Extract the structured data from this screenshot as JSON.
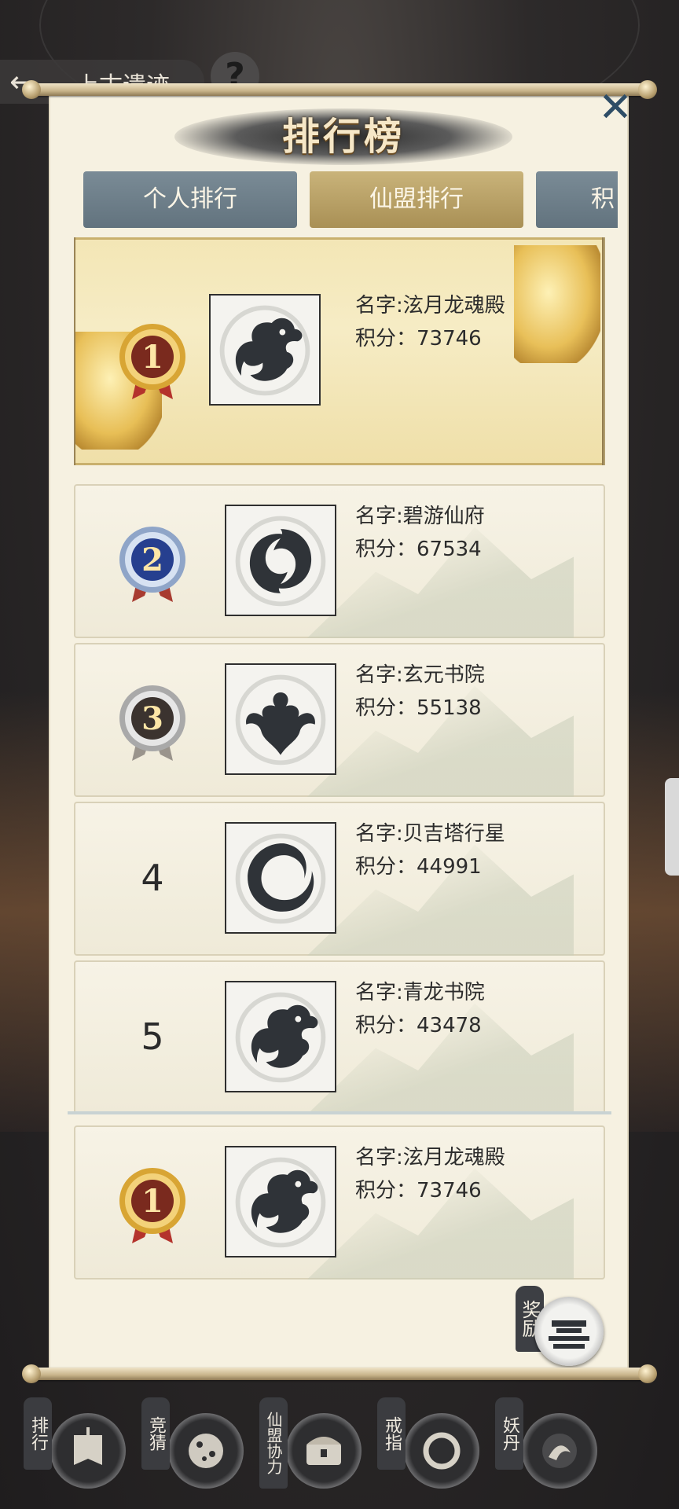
{
  "screen": {
    "background_title": "上古遗迹",
    "help_glyph": "?",
    "close_glyph": "✕"
  },
  "panel": {
    "title": "排行榜",
    "tabs": [
      {
        "label": "个人排行",
        "selected": false
      },
      {
        "label": "仙盟排行",
        "selected": true
      },
      {
        "label": "积",
        "selected": false
      }
    ]
  },
  "ranking": [
    {
      "rank": "1",
      "medal": "gold",
      "name": "名字:泫月龙魂殿",
      "score": "积分：73746",
      "emblem": "dragon-emblem"
    },
    {
      "rank": "2",
      "medal": "blue",
      "name": "名字:碧游仙府",
      "score": "积分：67534",
      "emblem": "wave-emblem"
    },
    {
      "rank": "3",
      "medal": "silver",
      "name": "名字:玄元书院",
      "score": "积分：55138",
      "emblem": "phoenix-emblem"
    },
    {
      "rank": "4",
      "medal": "none",
      "name": "名字:贝吉塔行星",
      "score": "积分：44991",
      "emblem": "crescent-emblem"
    },
    {
      "rank": "5",
      "medal": "none",
      "name": "名字:青龙书院",
      "score": "积分：43478",
      "emblem": "dragon-emblem"
    }
  ],
  "my_alliance": {
    "rank": "1",
    "medal": "gold",
    "name": "名字:泫月龙魂殿",
    "score": "积分：73746",
    "emblem": "dragon-emblem"
  },
  "reward": {
    "label": "奖励"
  },
  "bottom_nav": [
    {
      "label": "排行",
      "icon": "banner-icon"
    },
    {
      "label": "竞猜",
      "icon": "dice-icon"
    },
    {
      "label": "仙盟协力",
      "icon": "treasure-chest-icon"
    },
    {
      "label": "戒指",
      "icon": "ring-icon"
    },
    {
      "label": "妖丹",
      "icon": "orb-icon"
    }
  ],
  "colors": {
    "panel_bg": "#f6f1e1",
    "tab_selected": "#b9a166",
    "tab_unselected": "#6f808b",
    "close_icon": "#2e4d66",
    "emblem_ink": "#2f3338"
  }
}
